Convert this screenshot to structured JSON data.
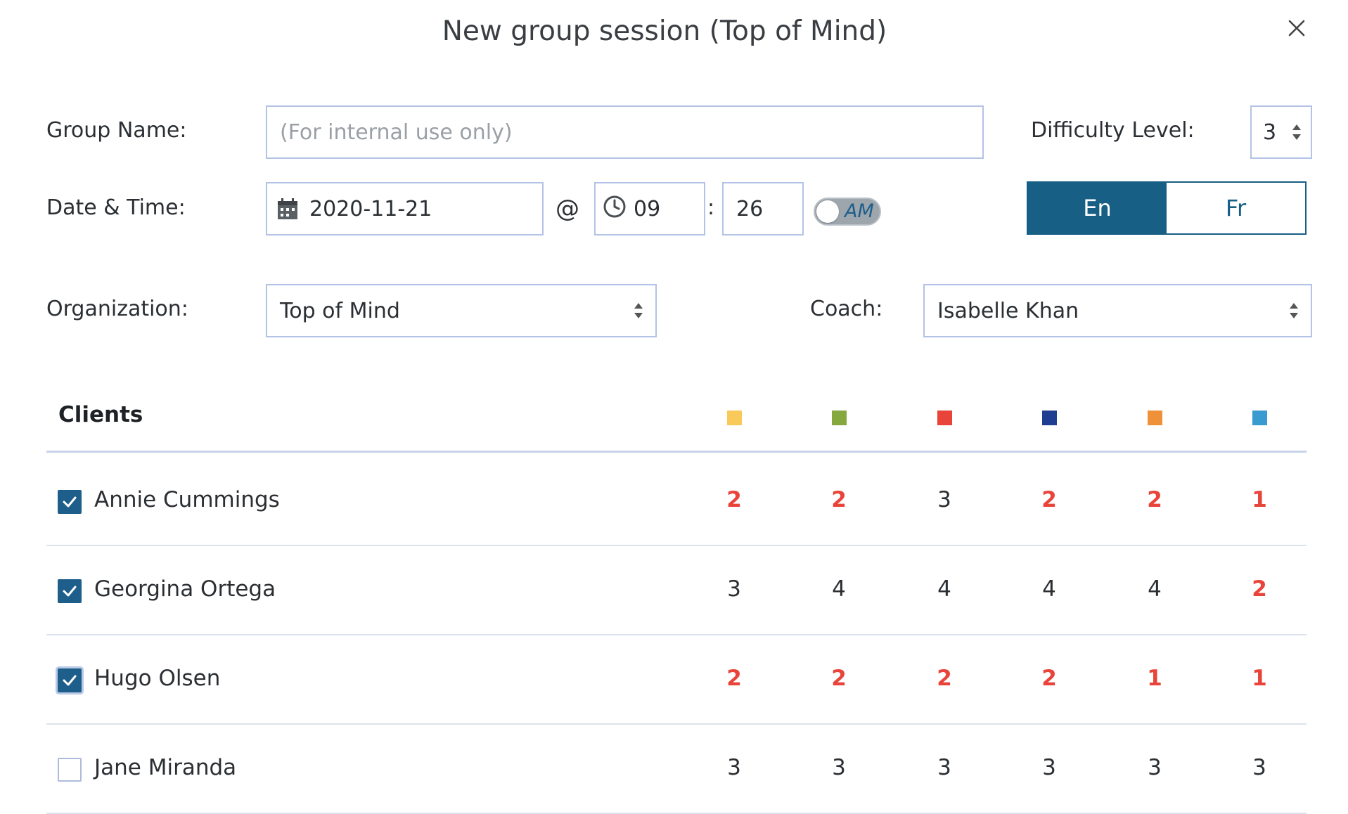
{
  "modal": {
    "title": "New group session (Top of Mind)"
  },
  "form": {
    "group_name_label": "Group Name:",
    "group_name_placeholder": "(For internal use only)",
    "group_name_value": "",
    "difficulty_label": "Difficulty Level:",
    "difficulty_value": "3",
    "datetime_label": "Date & Time:",
    "date_value": "2020-11-21",
    "at_symbol": "@",
    "hour_value": "09",
    "time_separator": ":",
    "minute_value": "26",
    "ampm_value": "AM",
    "languages": [
      {
        "label": "En",
        "active": true
      },
      {
        "label": "Fr",
        "active": false
      }
    ],
    "organization_label": "Organization:",
    "organization_value": "Top of Mind",
    "coach_label": "Coach:",
    "coach_value": "Isabelle Khan"
  },
  "clients": {
    "header": "Clients",
    "category_colors": [
      "#f9c95a",
      "#86a83f",
      "#e8443a",
      "#1f3d91",
      "#ef9138",
      "#3a9bd1"
    ],
    "low_score_color": "#e8443a",
    "rows": [
      {
        "name": "Annie Cummings",
        "checked": true,
        "scores": [
          "2",
          "2",
          "3",
          "2",
          "2",
          "1"
        ]
      },
      {
        "name": "Georgina Ortega",
        "checked": true,
        "scores": [
          "3",
          "4",
          "4",
          "4",
          "4",
          "2"
        ]
      },
      {
        "name": "Hugo Olsen",
        "checked": true,
        "scores": [
          "2",
          "2",
          "2",
          "2",
          "1",
          "1"
        ]
      },
      {
        "name": "Jane Miranda",
        "checked": false,
        "scores": [
          "3",
          "3",
          "3",
          "3",
          "3",
          "3"
        ]
      }
    ]
  }
}
